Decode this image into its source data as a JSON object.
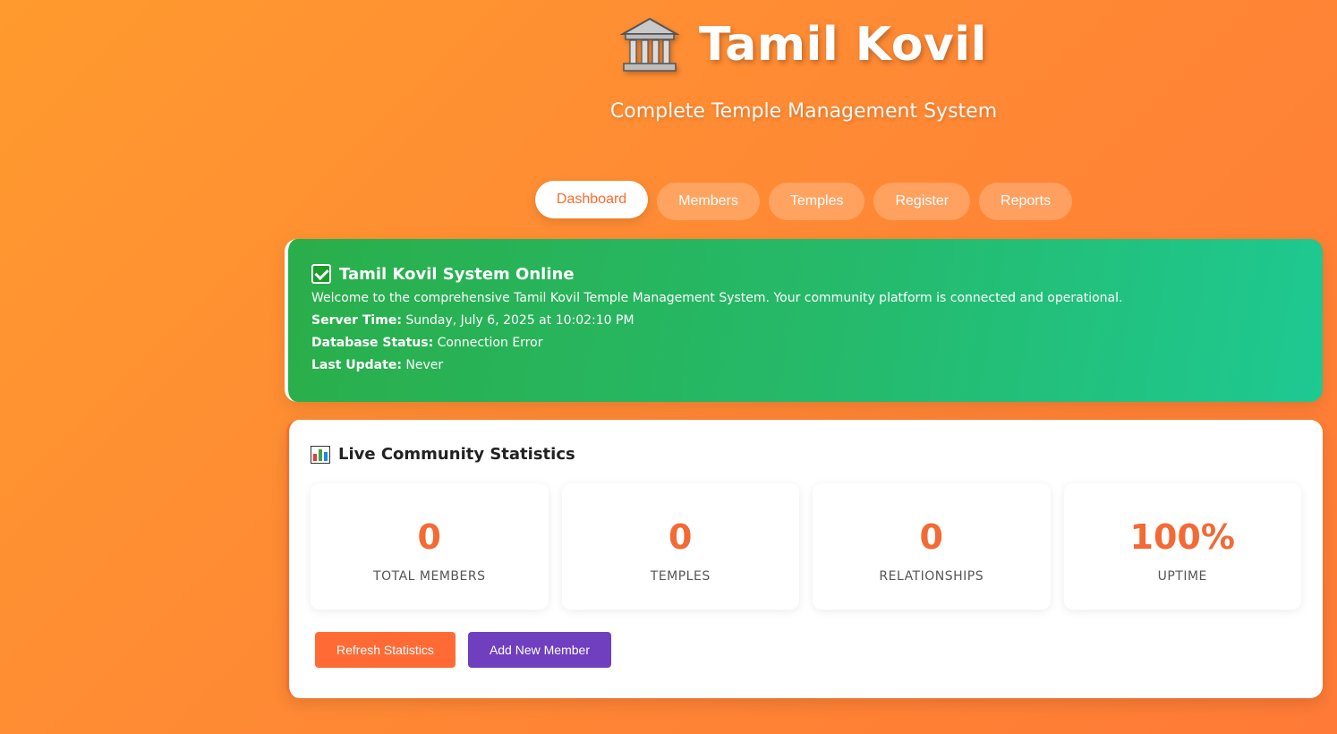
{
  "header": {
    "title": "Tamil Kovil",
    "subtitle": "Complete Temple Management System",
    "icon": "classical-building-icon"
  },
  "nav": {
    "tabs": [
      {
        "label": "Dashboard",
        "active": true
      },
      {
        "label": "Members",
        "active": false
      },
      {
        "label": "Temples",
        "active": false
      },
      {
        "label": "Register",
        "active": false
      },
      {
        "label": "Reports",
        "active": false
      }
    ]
  },
  "status": {
    "icon": "check-mark-icon",
    "title": "Tamil Kovil System Online",
    "description": "Welcome to the comprehensive Tamil Kovil Temple Management System. Your community platform is connected and operational.",
    "server_time_label": "Server Time:",
    "server_time_value": "Sunday, July 6, 2025 at 10:02:10 PM",
    "db_status_label": "Database Status:",
    "db_status_value": "Connection Error",
    "last_update_label": "Last Update:",
    "last_update_value": "Never"
  },
  "stats": {
    "icon": "bar-chart-icon",
    "title": "Live Community Statistics",
    "items": [
      {
        "value": "0",
        "label": "TOTAL MEMBERS"
      },
      {
        "value": "0",
        "label": "TEMPLES"
      },
      {
        "value": "0",
        "label": "RELATIONSHIPS"
      },
      {
        "value": "100%",
        "label": "UPTIME"
      }
    ],
    "refresh_label": "Refresh Statistics",
    "add_member_label": "Add New Member"
  },
  "colors": {
    "accent": "#ff6a35",
    "success": "#25ba6c",
    "purple": "#6f3fbf"
  }
}
